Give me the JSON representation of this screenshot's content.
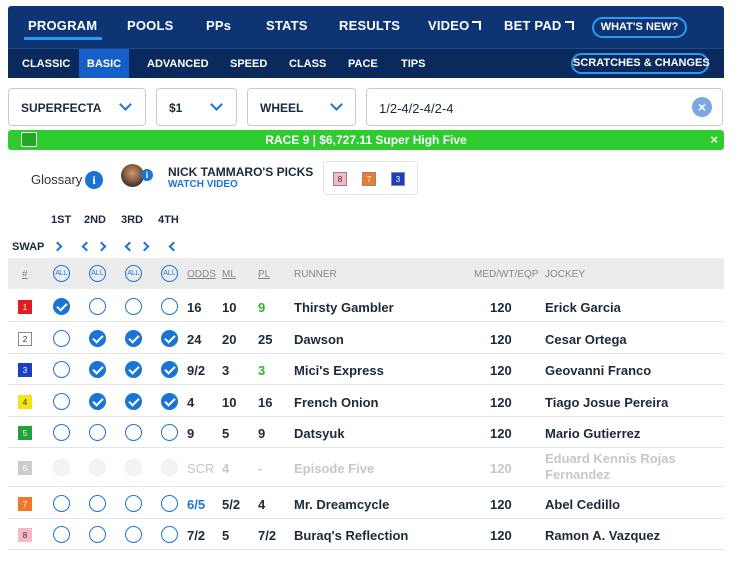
{
  "nav_primary": [
    {
      "label": "PROGRAM",
      "external": false
    },
    {
      "label": "POOLS",
      "external": false
    },
    {
      "label": "PPs",
      "external": false
    },
    {
      "label": "STATS",
      "external": false
    },
    {
      "label": "RESULTS",
      "external": false
    },
    {
      "label": "VIDEO",
      "external": true
    },
    {
      "label": "BET PAD",
      "external": true
    }
  ],
  "whats_new": "WHAT'S NEW?",
  "nav_secondary": [
    "CLASSIC",
    "BASIC",
    "ADVANCED",
    "SPEED",
    "CLASS",
    "PACE",
    "TIPS"
  ],
  "scratches": "SCRATCHES & CHANGES",
  "bet": {
    "type": "SUPERFECTA",
    "amount": "$1",
    "modifier": "WHEEL",
    "selection": "1/2-4/2-4/2-4"
  },
  "banner": {
    "text": "RACE 9 | $6,727.11 Super High Five",
    "close": "×"
  },
  "glossary": "Glossary",
  "picks": {
    "name": "NICK TAMMARO'S PICKS",
    "watch": "WATCH VIDEO",
    "numbers": [
      "8",
      "7",
      "3"
    ]
  },
  "positions": [
    "1ST",
    "2ND",
    "3RD",
    "4TH"
  ],
  "swap": "SWAP",
  "all_label": "ALL",
  "headers": {
    "num": "#",
    "odds": "ODDS",
    "ml": "ML",
    "pl": "PL",
    "runner": "RUNNER",
    "med": "MED/WT/EQP",
    "jockey": "JOCKEY"
  },
  "colors": {
    "nav": "#0d3573",
    "accent": "#1a74d4",
    "banner": "#2ecc2e"
  },
  "runners": [
    {
      "num": "1",
      "odds": "16",
      "ml": "10",
      "pl": "9",
      "runner": "Thirsty Gambler",
      "wt": "120",
      "jockey": "Erick Garcia",
      "picks": [
        true,
        false,
        false,
        false
      ],
      "scratched": false,
      "pl_green": true,
      "odds_blue": false,
      "saddle": "#e31b23",
      "saddle_text": "#ffffff"
    },
    {
      "num": "2",
      "odds": "24",
      "ml": "20",
      "pl": "25",
      "runner": "Dawson",
      "wt": "120",
      "jockey": "Cesar Ortega",
      "picks": [
        false,
        true,
        true,
        true
      ],
      "scratched": false,
      "pl_green": false,
      "odds_blue": false,
      "saddle": "#ffffff",
      "saddle_text": "#333333"
    },
    {
      "num": "3",
      "odds": "9/2",
      "ml": "3",
      "pl": "3",
      "runner": "Mici's Express",
      "wt": "120",
      "jockey": "Geovanni Franco",
      "picks": [
        false,
        true,
        true,
        true
      ],
      "scratched": false,
      "pl_green": true,
      "odds_blue": false,
      "saddle": "#1a3fbf",
      "saddle_text": "#ffffff"
    },
    {
      "num": "4",
      "odds": "4",
      "ml": "10",
      "pl": "16",
      "runner": "French Onion",
      "wt": "120",
      "jockey": "Tiago Josue Pereira",
      "picks": [
        false,
        true,
        true,
        true
      ],
      "scratched": false,
      "pl_green": false,
      "odds_blue": false,
      "saddle": "#f4e21a",
      "saddle_text": "#333333"
    },
    {
      "num": "5",
      "odds": "9",
      "ml": "5",
      "pl": "9",
      "runner": "Datsyuk",
      "wt": "120",
      "jockey": "Mario Gutierrez",
      "picks": [
        false,
        false,
        false,
        false
      ],
      "scratched": false,
      "pl_green": false,
      "odds_blue": false,
      "saddle": "#23a23a",
      "saddle_text": "#ffffff"
    },
    {
      "num": "6",
      "odds": "SCR",
      "ml": "4",
      "pl": "-",
      "runner": "Episode Five",
      "wt": "120",
      "jockey": "Eduard Kennis Rojas Fernandez",
      "picks": [
        false,
        false,
        false,
        false
      ],
      "scratched": true,
      "pl_green": false,
      "odds_blue": false,
      "saddle": "#cccccc",
      "saddle_text": "#ffffff"
    },
    {
      "num": "7",
      "odds": "6/5",
      "ml": "5/2",
      "pl": "4",
      "runner": "Mr. Dreamcycle",
      "wt": "120",
      "jockey": "Abel Cedillo",
      "picks": [
        false,
        false,
        false,
        false
      ],
      "scratched": false,
      "pl_green": false,
      "odds_blue": true,
      "saddle": "#f07a2a",
      "saddle_text": "#ffffff"
    },
    {
      "num": "8",
      "odds": "7/2",
      "ml": "5",
      "pl": "7/2",
      "runner": "Buraq's Reflection",
      "wt": "120",
      "jockey": "Ramon A. Vazquez",
      "picks": [
        false,
        false,
        false,
        false
      ],
      "scratched": false,
      "pl_green": false,
      "odds_blue": false,
      "saddle": "#f7b7c7",
      "saddle_text": "#333333"
    }
  ]
}
